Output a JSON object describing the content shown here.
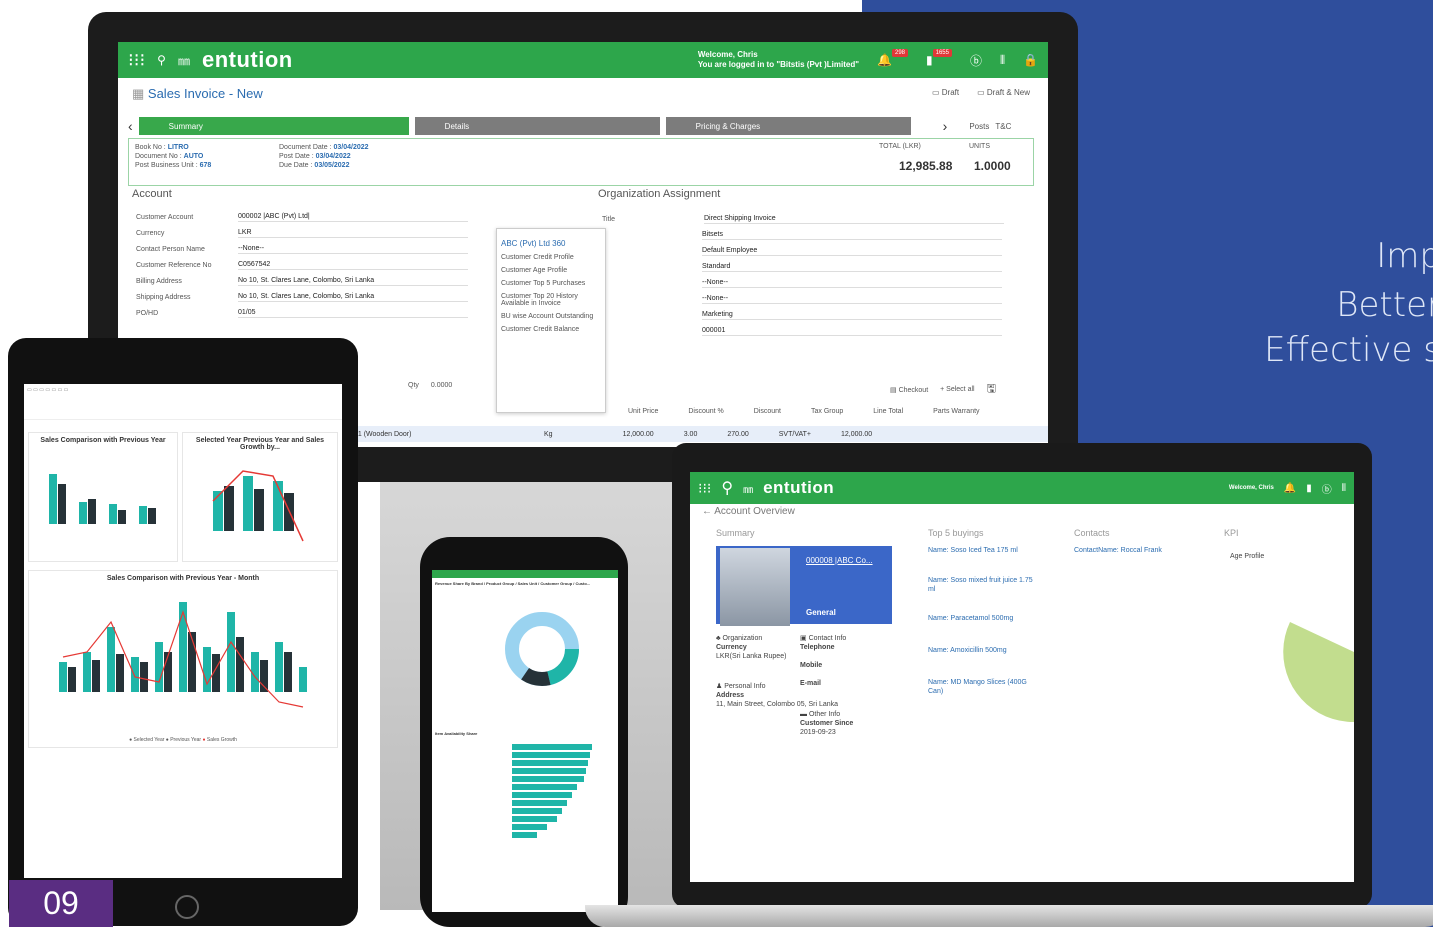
{
  "page_number": "09",
  "taglines": [
    "Imp",
    "Better",
    "Effective s"
  ],
  "desktop": {
    "app_name": "entution",
    "welcome_line1": "Welcome, Chris",
    "welcome_line2": "You are logged in to \"Bitstis (Pvt )Limited\"",
    "notif_badge": "298",
    "task_badge": "1655",
    "page_title": "Sales Invoice - New",
    "action_draft": "Draft",
    "action_draft_new": "Draft & New",
    "step_summary": "Summary",
    "step_details": "Details",
    "step_pricing": "Pricing & Charges",
    "link_posts": "Posts",
    "link_tc": "T&C",
    "book_no_label": "Book No",
    "book_no": "LITRO",
    "doc_no_label": "Document No",
    "doc_no": "AUTO",
    "post_bu_label": "Post Business Unit",
    "post_bu": "678",
    "doc_date_label": "Document Date",
    "doc_date": "03/04/2022",
    "post_date_label": "Post Date",
    "post_date": "03/04/2022",
    "due_date_label": "Due Date",
    "due_date": "03/05/2022",
    "total_label": "TOTAL (LKR)",
    "total": "12,985.88",
    "units_label": "UNITS",
    "units": "1.0000",
    "account_title": "Account",
    "org_title": "Organization Assignment",
    "customer_account_label": "Customer Account",
    "customer_account": "000002 |ABC (Pvt) Ltd|",
    "currency_label": "Currency",
    "currency": "LKR",
    "contact_label": "Contact Person Name",
    "contact": "--None--",
    "customer_ref_label": "Customer Reference No",
    "customer_ref": "C0567542",
    "billing_label": "Billing Address",
    "billing": "No 10, St. Clares Lane, Colombo, Sri Lanka",
    "shipping_label": "Shipping Address",
    "shipping": "No 10, St. Clares Lane, Colombo, Sri Lanka",
    "pohd_label": "PO/HD",
    "pohd": "01/05",
    "dd_title": "ABC (Pvt) Ltd 360",
    "dd_items": [
      "Customer Credit Profile",
      "Customer Age Profile",
      "Customer Top 5 Purchases",
      "Customer Top 20 History Available in Invoice",
      "BU wise Account Outstanding",
      "Customer Credit Balance"
    ],
    "org_title_label": "Title",
    "org_title_val": "Direct Shipping Invoice",
    "org_row2": "Bitsets",
    "org_row3": "Default Employee",
    "org_row4": "Standard",
    "org_row5": "--None--",
    "org_row6": "--None--",
    "org_row7": "Marketing",
    "org_row8": "000001",
    "checkout": "Checkout",
    "select_all": "+ Select all",
    "qty_label": "Qty",
    "qty_val": "0.0000",
    "grid_cols": [
      "Unit Price",
      "Discount %",
      "Discount",
      "Tax Group",
      "Line Total",
      "Parts Warranty"
    ],
    "grid_row": {
      "product": "01 (Wooden Door)",
      "uom": "Kg",
      "price": "12,000.00",
      "disc_pct": "3.00",
      "disc": "270.00",
      "tax": "SVT/VAT+",
      "line_total": "12,000.00"
    }
  },
  "tablet": {
    "chart1_title": "Sales Comparison with Previous Year",
    "chart2_title": "Selected Year Previous Year and Sales Growth by...",
    "chart3_title": "Sales Comparison with Previous Year - Month",
    "legend": [
      "Selected Year",
      "Previous Year",
      "Sales Growth"
    ]
  },
  "phone": {
    "chart_title": "Revenue Share By Brand / Product Group / Sales Unit / Customer Group / Custo...",
    "bar_title": "Item Availability Share"
  },
  "laptop": {
    "app_name": "entution",
    "welcome": "Welcome, Chris",
    "page_title": "Account Overview",
    "col_summary": "Summary",
    "col_top": "Top 5 buyings",
    "col_contacts": "Contacts",
    "col_kpi": "KPI",
    "account_name": "000008 |ABC Co...",
    "account_type": "General",
    "org_label": "Organization",
    "currency_label": "Currency",
    "currency": "LKR(Sri Lanka Rupee)",
    "contact_info": "Contact Info",
    "telephone": "Telephone",
    "mobile": "Mobile",
    "email": "E-mail",
    "personal_info": "Personal Info",
    "address_label": "Address",
    "address": "11, Main Street, Colombo 05, Sri Lanka",
    "other_info": "Other Info",
    "customer_since": "Customer Since",
    "customer_since_val": "2019-09-23",
    "items": [
      "Name: Soso Iced Tea 175 ml",
      "Name: Soso mixed fruit juice 1.75 ml",
      "Name: Paracetamol 500mg",
      "Name: Amoxicillin 500mg",
      "Name: MD Mango Slices (400G Can)"
    ],
    "contact_name": "ContactName: Roccal Frank",
    "kpi_title": "Age Profile"
  }
}
